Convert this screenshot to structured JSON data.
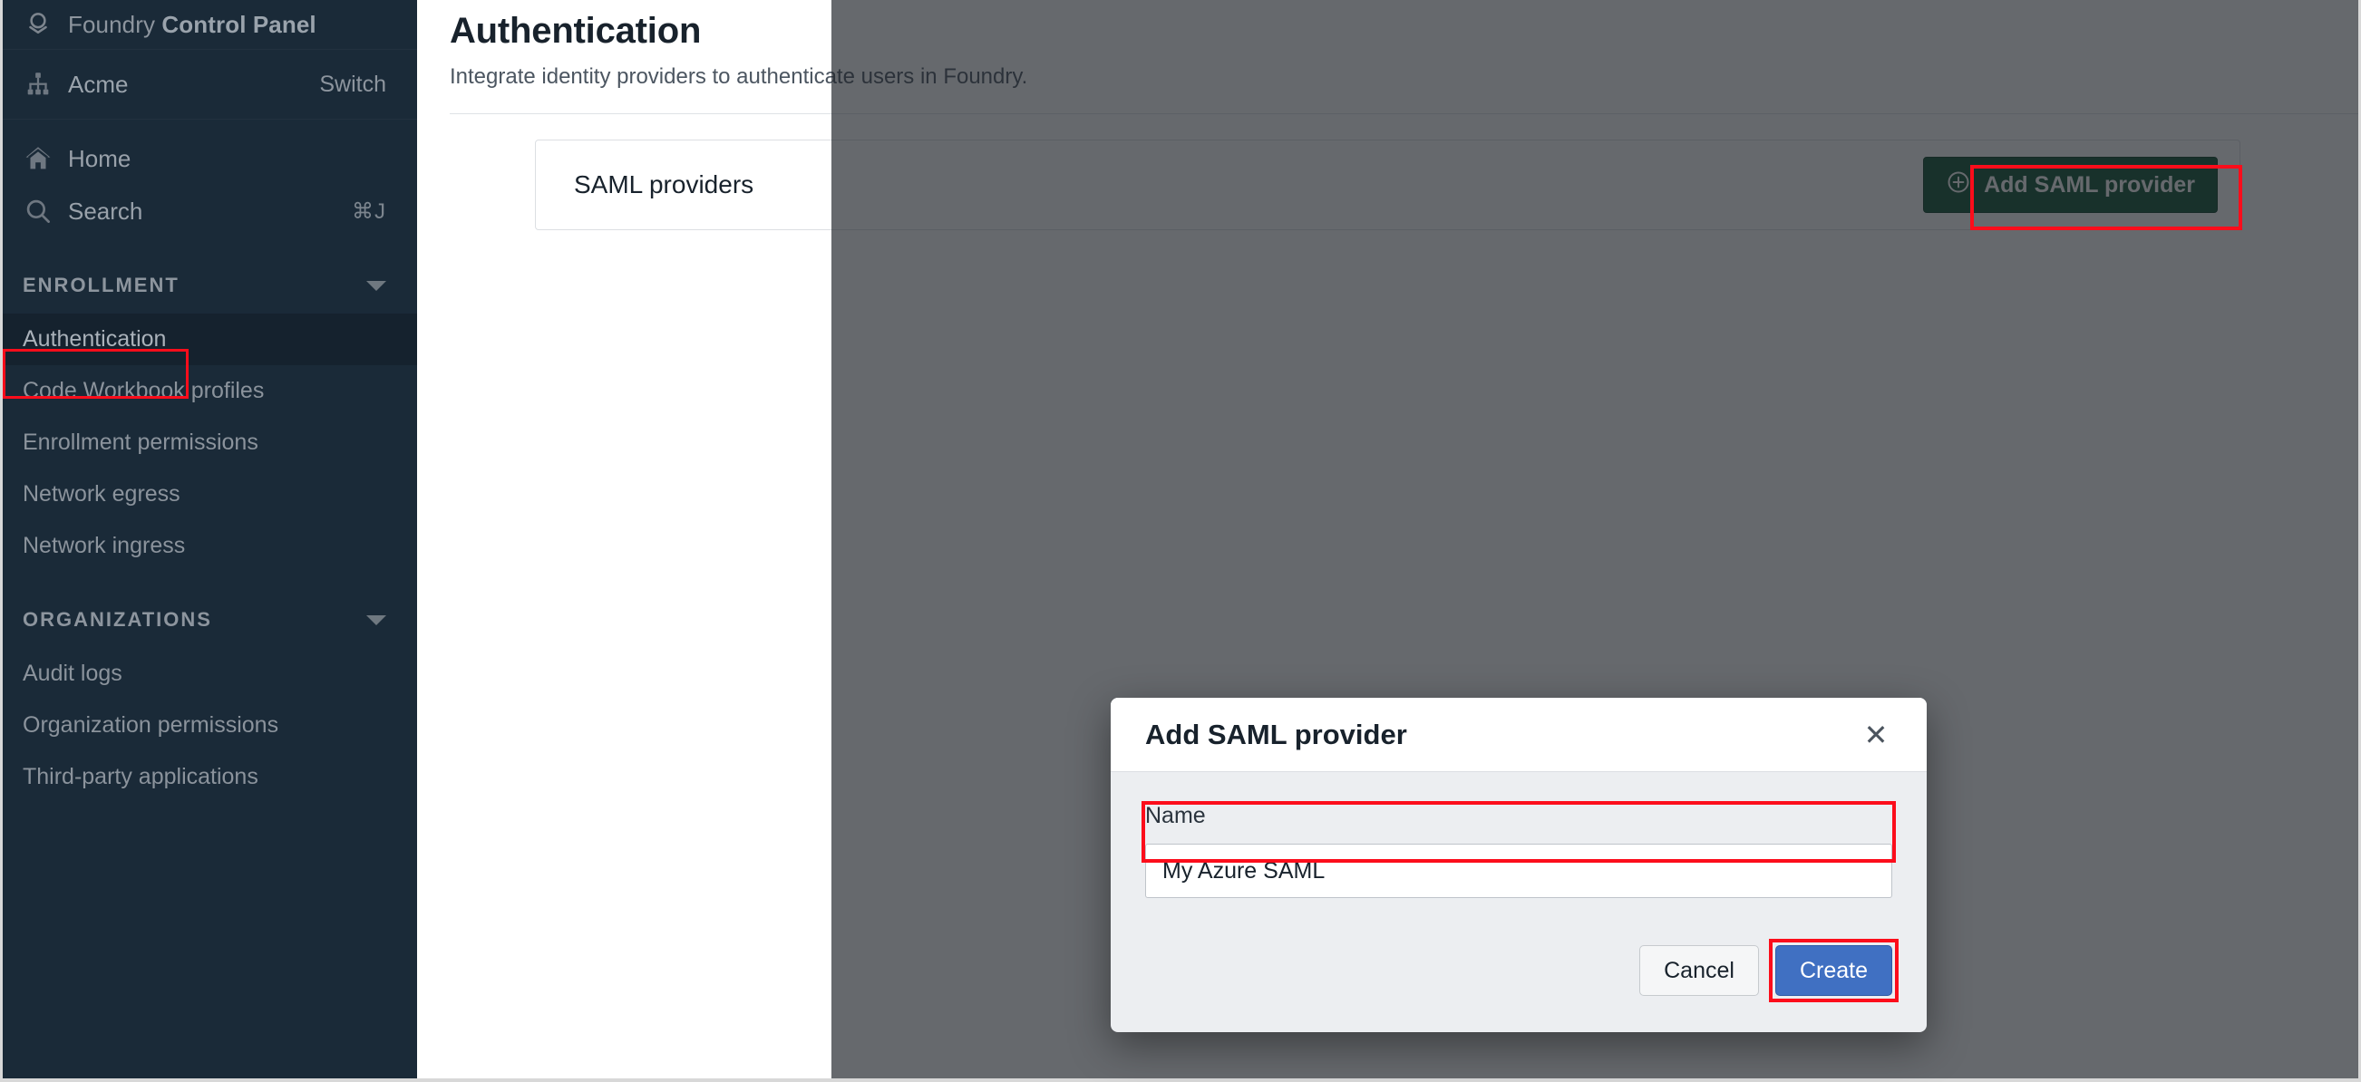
{
  "sidebar": {
    "brand": {
      "prefix": "Foundry ",
      "bold": "Control Panel",
      "icon": "foundry-logo-icon"
    },
    "org": {
      "name": "Acme",
      "switch_label": "Switch",
      "icon": "org-tree-icon"
    },
    "nav": [
      {
        "label": "Home",
        "icon": "home-icon",
        "shortcut": ""
      },
      {
        "label": "Search",
        "icon": "search-icon",
        "shortcut": "⌘J"
      }
    ],
    "sections": [
      {
        "title": "ENROLLMENT",
        "caret": "chevron-down-icon",
        "items": [
          {
            "label": "Authentication",
            "active": true
          },
          {
            "label": "Code Workbook profiles",
            "active": false
          },
          {
            "label": "Enrollment permissions",
            "active": false
          },
          {
            "label": "Network egress",
            "active": false
          },
          {
            "label": "Network ingress",
            "active": false
          }
        ]
      },
      {
        "title": "ORGANIZATIONS",
        "caret": "chevron-down-icon",
        "items": [
          {
            "label": "Audit logs",
            "active": false
          },
          {
            "label": "Organization permissions",
            "active": false
          },
          {
            "label": "Third-party applications",
            "active": false
          }
        ]
      }
    ]
  },
  "main": {
    "title": "Authentication",
    "subtitle": "Integrate identity providers to authenticate users in Foundry.",
    "card": {
      "title": "SAML providers",
      "add_button_label": "Add SAML provider",
      "add_button_icon": "plus-circle-icon",
      "add_button_color": "#0f5132"
    }
  },
  "modal": {
    "title": "Add SAML provider",
    "close_icon": "close-icon",
    "field_label": "Name",
    "field_value": "My Azure SAML",
    "field_placeholder": "",
    "cancel_label": "Cancel",
    "create_label": "Create",
    "create_color": "#4070c2"
  },
  "annotations": {
    "highlight_color": "#fc0d1b",
    "targets": [
      "sidebar-item-authentication",
      "add-saml-provider-button",
      "name-field",
      "create-button"
    ]
  }
}
